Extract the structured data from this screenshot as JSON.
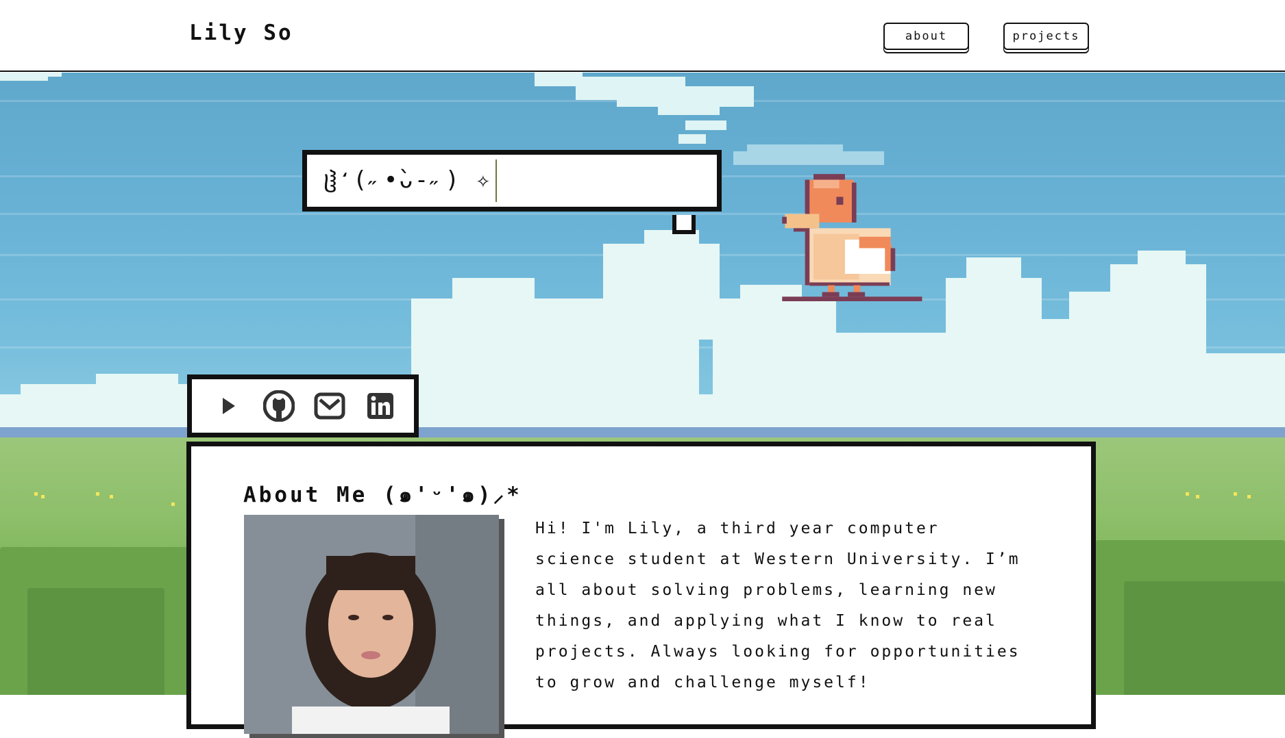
{
  "header": {
    "brand": "Lily So",
    "nav": [
      {
        "label": "about"
      },
      {
        "label": "projects"
      }
    ]
  },
  "hero": {
    "bubble_text": "ჱ̒(˶•̀ᴗ-˶) ✧"
  },
  "social": {
    "icons": [
      "play-icon",
      "github-icon",
      "mail-icon",
      "linkedin-icon"
    ]
  },
  "about": {
    "title": "About Me (๑'ᵕ'๑)⸝*",
    "body": "Hi! I'm Lily, a third year computer science student at Western University. I’m all about solving problems, learning new things, and applying what I know to real projects. Always looking for opportunities to grow and challenge myself!"
  },
  "colors": {
    "sky": "#69b2d6",
    "grass": "#8ebf6a",
    "border": "#111111",
    "duck_orange": "#f08a5a"
  }
}
